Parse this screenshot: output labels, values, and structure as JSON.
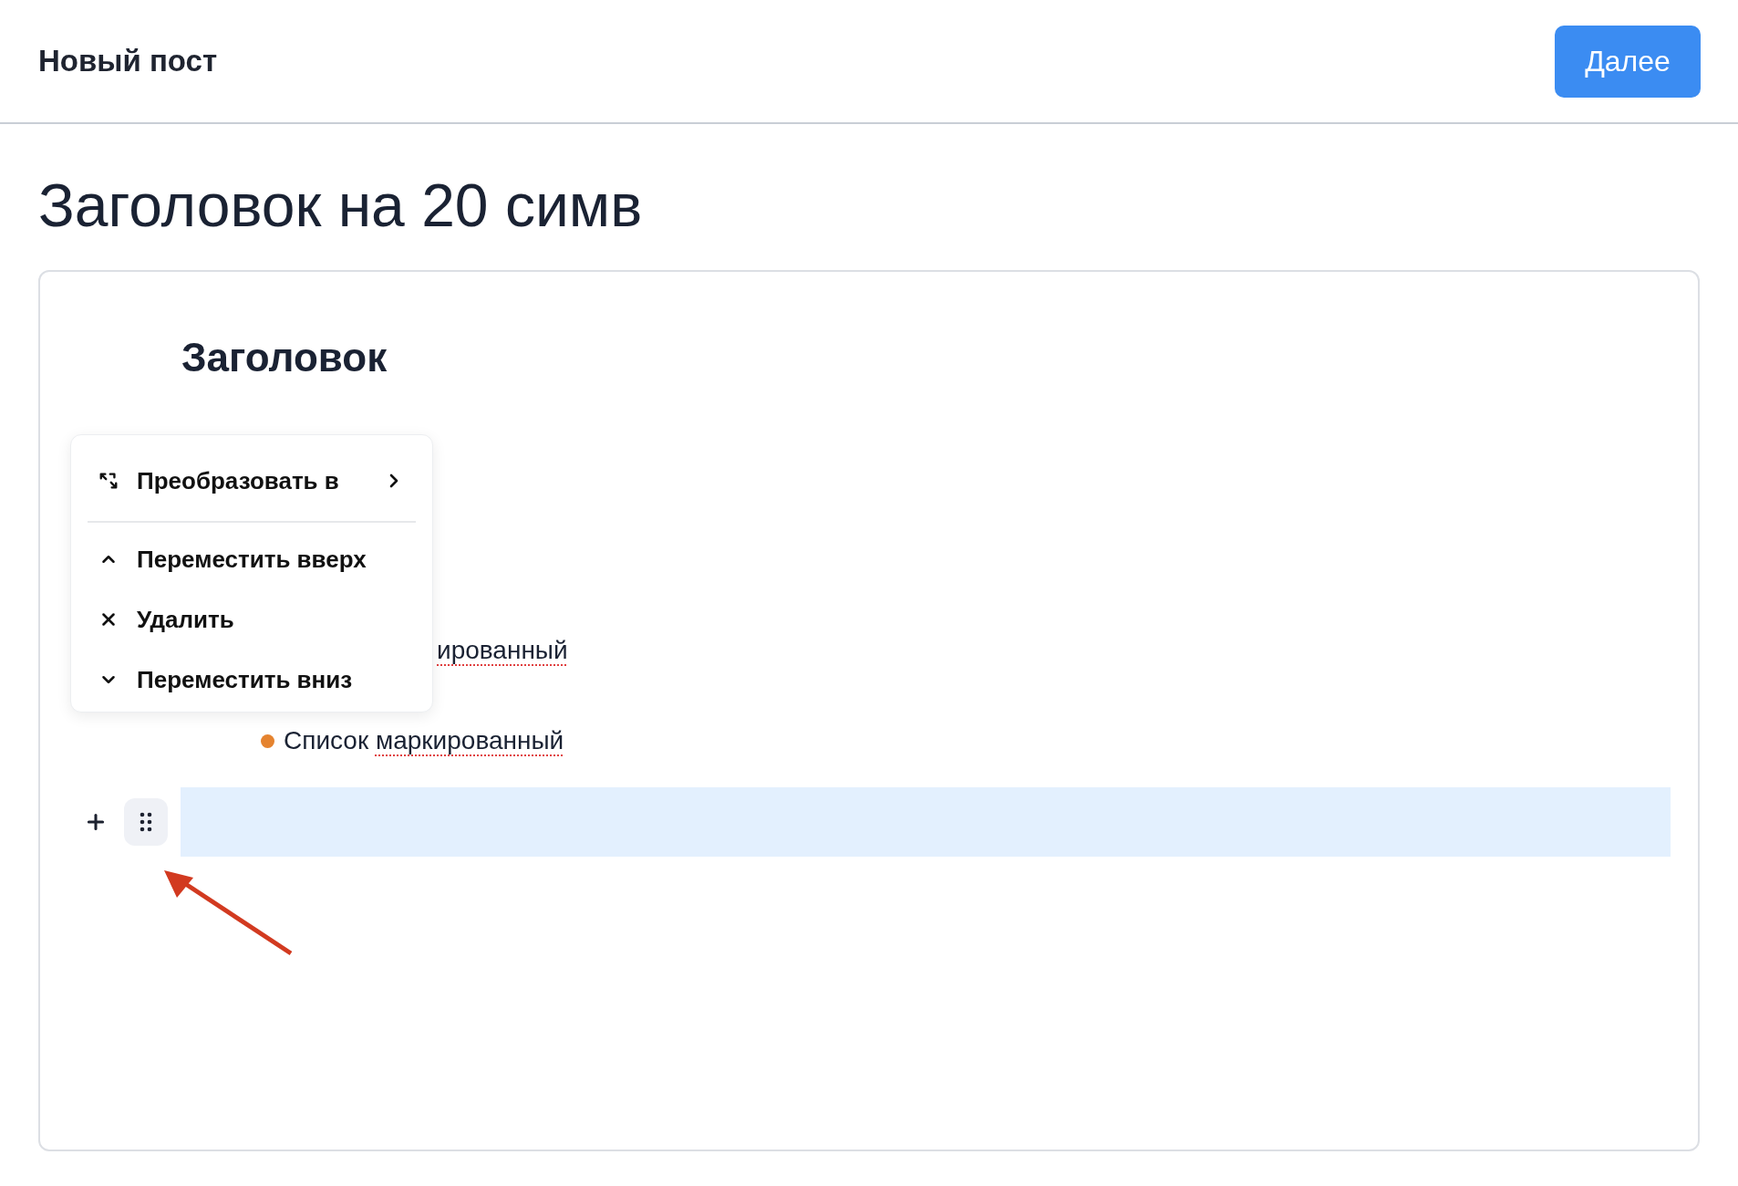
{
  "header": {
    "title": "Новый пост",
    "next_button": "Далее"
  },
  "post_title": "Заголовок на 20 симв",
  "editor": {
    "blocks": [
      {
        "kind": "heading",
        "text": "Заголовок"
      },
      {
        "kind": "bullet_partial",
        "parts": [
          {
            "text": "ированный",
            "misspelled": true
          }
        ]
      },
      {
        "kind": "bullet",
        "color": "#e5832f",
        "parts": [
          {
            "text": "Список ",
            "misspelled": false
          },
          {
            "text": "маркированный",
            "misspelled": true
          }
        ]
      },
      {
        "kind": "empty",
        "selected": true
      }
    ],
    "block_menu": {
      "items": [
        {
          "kind": "convert",
          "label": "Преобразовать в",
          "submenu": true
        },
        {
          "kind": "up",
          "label": "Переместить вверх",
          "submenu": false
        },
        {
          "kind": "delete",
          "label": "Удалить",
          "submenu": false
        },
        {
          "kind": "down",
          "label": "Переместить вниз",
          "submenu": false
        }
      ]
    }
  }
}
